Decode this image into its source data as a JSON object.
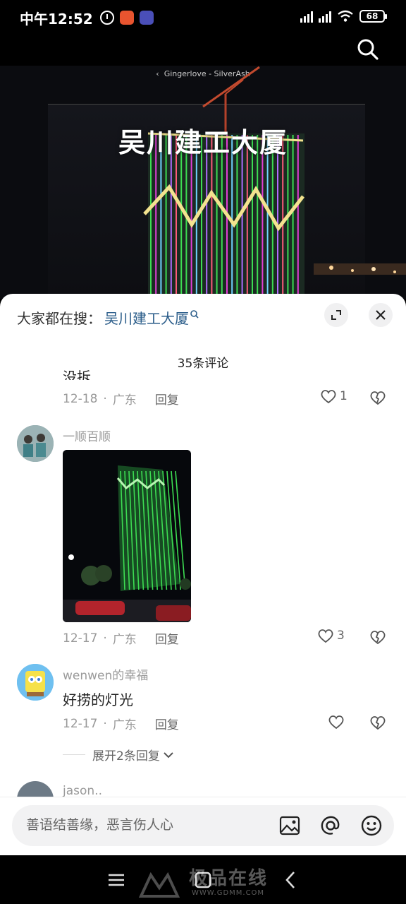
{
  "status_bar": {
    "time": "中午12:52",
    "battery": "68"
  },
  "video": {
    "subtitle": "Gingerlove - SilverAsh",
    "title": "吴川建工大厦"
  },
  "sheet": {
    "search_prefix": "大家都在搜：",
    "search_term": "吴川建工大厦",
    "comment_count": "35条评论"
  },
  "comments": [
    {
      "text_partial": "没拆",
      "date": "12-18",
      "location": "广东",
      "reply": "回复",
      "likes": "1"
    },
    {
      "username": "一顺百顺",
      "date": "12-17",
      "location": "广东",
      "reply": "回复",
      "likes": "3"
    },
    {
      "username": "wenwen的幸福",
      "text": "好捞的灯光",
      "date": "12-17",
      "location": "广东",
      "reply": "回复",
      "likes": "",
      "expand_replies": "展开2条回复"
    },
    {
      "username": "jason.."
    }
  ],
  "input": {
    "placeholder": "善语结善缘，恶言伤人心"
  },
  "watermark": {
    "text": "极品在线",
    "url": "WWW.GDMM.COM"
  },
  "colors": {
    "search_term": "#2b5d8a",
    "meta": "#999999",
    "building_green": "#3ddc52"
  }
}
